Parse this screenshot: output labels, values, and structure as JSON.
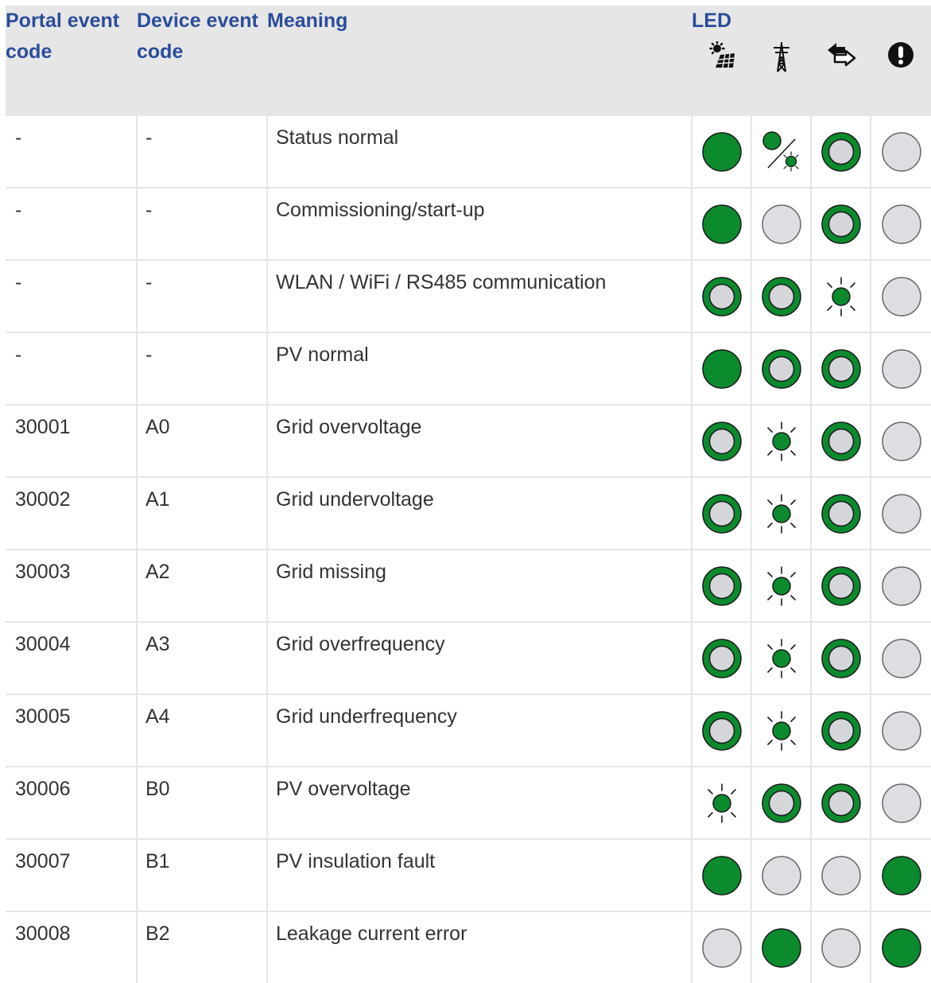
{
  "table": {
    "headers": {
      "portal": "Portal event code",
      "device": "Device event code",
      "meaning": "Meaning",
      "led": "LED"
    },
    "led_icons": [
      "pv-sun-icon",
      "grid-pylon-icon",
      "communication-arrow-icon",
      "warning-exclamation-icon"
    ],
    "legend_states": {
      "on": "green filled",
      "ring": "green outline ring",
      "off": "grey off",
      "blink": "green flashing",
      "alt": "green alternating"
    },
    "rows": [
      {
        "portal": "-",
        "device": "-",
        "meaning": "Status normal",
        "leds": [
          "on",
          "alt",
          "ring",
          "off"
        ]
      },
      {
        "portal": "-",
        "device": "-",
        "meaning": "Commissioning/start-up",
        "leds": [
          "on",
          "off",
          "ring",
          "off"
        ]
      },
      {
        "portal": "-",
        "device": "-",
        "meaning": "WLAN / WiFi / RS485 communication",
        "leds": [
          "ring",
          "ring",
          "blink",
          "off"
        ]
      },
      {
        "portal": "-",
        "device": "-",
        "meaning": "PV normal",
        "leds": [
          "on",
          "ring",
          "ring",
          "off"
        ]
      },
      {
        "portal": "30001",
        "device": "A0",
        "meaning": "Grid overvoltage",
        "leds": [
          "ring",
          "blink",
          "ring",
          "off"
        ]
      },
      {
        "portal": "30002",
        "device": "A1",
        "meaning": "Grid undervoltage",
        "leds": [
          "ring",
          "blink",
          "ring",
          "off"
        ]
      },
      {
        "portal": "30003",
        "device": "A2",
        "meaning": "Grid missing",
        "leds": [
          "ring",
          "blink",
          "ring",
          "off"
        ]
      },
      {
        "portal": "30004",
        "device": "A3",
        "meaning": "Grid overfrequency",
        "leds": [
          "ring",
          "blink",
          "ring",
          "off"
        ]
      },
      {
        "portal": "30005",
        "device": "A4",
        "meaning": "Grid underfrequency",
        "leds": [
          "ring",
          "blink",
          "ring",
          "off"
        ]
      },
      {
        "portal": "30006",
        "device": "B0",
        "meaning": "PV overvoltage",
        "leds": [
          "blink",
          "ring",
          "ring",
          "off"
        ]
      },
      {
        "portal": "30007",
        "device": "B1",
        "meaning": "PV insulation fault",
        "leds": [
          "on",
          "off",
          "off",
          "on"
        ]
      },
      {
        "portal": "30008",
        "device": "B2",
        "meaning": "Leakage current error",
        "leds": [
          "off",
          "on",
          "off",
          "on"
        ]
      }
    ]
  },
  "colors": {
    "header_text": "#2b4c9b",
    "header_bg": "#e6e6e6",
    "led_green": "#0b8a2e",
    "led_ring_inner": "#d4d6d9",
    "led_off_fill": "#dcdee1",
    "led_off_stroke": "#666666",
    "body_text": "#333333"
  }
}
